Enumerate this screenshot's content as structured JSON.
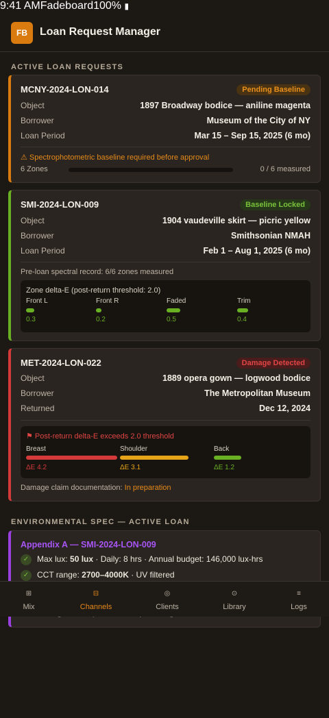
{
  "status_bar": {
    "time": "9:41 AM",
    "carrier": "Fadeboard",
    "battery": "100%"
  },
  "app": {
    "logo": "FB",
    "title": "Loan Request Manager"
  },
  "sections": {
    "active": "ACTIVE LOAN REQUESTS",
    "env": "ENVIRONMENTAL SPEC — ACTIVE LOAN"
  },
  "loans": [
    {
      "id": "MCNY-2024-LON-014",
      "status": "Pending Baseline",
      "status_color": "#e98f1b",
      "rows": [
        {
          "k": "Object",
          "v": "1897 Broadway bodice — aniline magenta"
        },
        {
          "k": "Borrower",
          "v": "Museum of the City of NY"
        },
        {
          "k": "Loan Period",
          "v": "Mar 15 – Sep 15, 2025 (6 mo)"
        }
      ],
      "warning": "⚠ Spectrophotometric baseline required before approval",
      "zones_label": "6 Zones",
      "measured": "0 / 6 measured",
      "measured_fraction": 0
    },
    {
      "id": "SMI-2024-LON-009",
      "status": "Baseline Locked",
      "status_color": "#78c03a",
      "rows": [
        {
          "k": "Object",
          "v": "1904 vaudeville skirt — picric yellow"
        },
        {
          "k": "Borrower",
          "v": "Smithsonian NMAH"
        },
        {
          "k": "Loan Period",
          "v": "Feb 1 – Aug 1, 2025 (6 mo)"
        }
      ],
      "record_note": "Pre-loan spectral record: 6/6 zones measured",
      "zone_title": "Zone delta-E (post-return threshold: 2.0)",
      "zones": [
        {
          "label": "Front L",
          "value": "0.3"
        },
        {
          "label": "Front R",
          "value": "0.2"
        },
        {
          "label": "Faded",
          "value": "0.5"
        },
        {
          "label": "Trim",
          "value": "0.4"
        }
      ]
    },
    {
      "id": "MET-2024-LON-022",
      "status": "Damage Detected",
      "status_color": "#e04545",
      "rows": [
        {
          "k": "Object",
          "v": "1889 opera gown — logwood bodice"
        },
        {
          "k": "Borrower",
          "v": "The Metropolitan Museum"
        },
        {
          "k": "Returned",
          "v": "Dec 12, 2024"
        }
      ],
      "alert": "⚑ Post-return delta-E exceeds 2.0 threshold",
      "zones": [
        {
          "label": "Breast",
          "value": "ΔE 4.2",
          "color": "#d43a3a"
        },
        {
          "label": "Shoulder",
          "value": "ΔE 3.1",
          "color": "#e6a418"
        },
        {
          "label": "Back",
          "value": "ΔE 1.2",
          "color": "#6ab023"
        }
      ],
      "claim_label": "Damage claim documentation: ",
      "claim_status": "In preparation"
    }
  ],
  "env_spec": {
    "title": "Appendix A — SMI-2024-LON-009",
    "lux_prefix": "Max lux: ",
    "lux_value": "50 lux",
    "lux_suffix": " · Daily: 8 hrs · Annual budget: 146,000 lux-hrs",
    "cct_prefix": "CCT range: ",
    "cct_value": "2700–4000K",
    "cct_suffix": " · UV filtered",
    "footer_note": "Conservator signature req'd before loan period begins"
  },
  "tabs": [
    {
      "label": "Mix",
      "icon": "mix-icon",
      "glyph": "⊞"
    },
    {
      "label": "Channels",
      "icon": "channels-icon",
      "glyph": "⊟"
    },
    {
      "label": "Clients",
      "icon": "clients-icon",
      "glyph": "◎"
    },
    {
      "label": "Library",
      "icon": "library-icon",
      "glyph": "⊙"
    },
    {
      "label": "Logs",
      "icon": "logs-icon",
      "glyph": "≡"
    }
  ],
  "active_tab": "Channels",
  "colors": {
    "accent": "#d97b0e",
    "ok": "#6ab023",
    "danger": "#d43a3a",
    "spec": "#a855f7"
  }
}
